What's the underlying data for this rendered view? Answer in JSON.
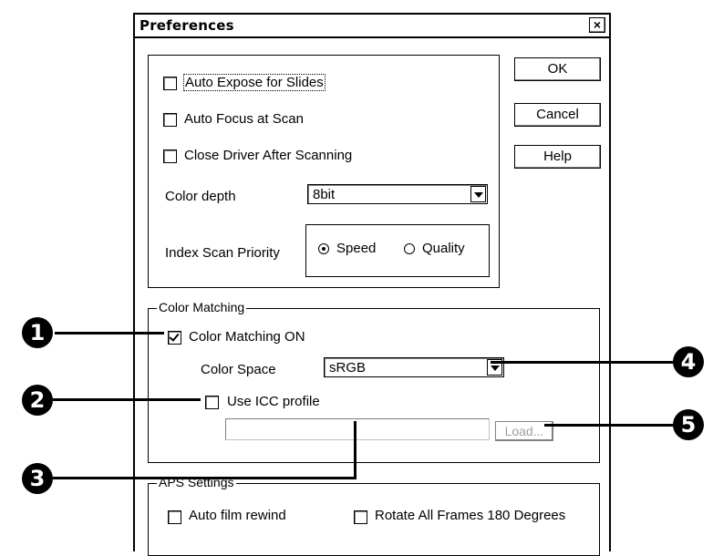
{
  "dialog": {
    "title": "Preferences",
    "close_glyph": "×",
    "ok_label": "OK",
    "cancel_label": "Cancel",
    "help_label": "Help"
  },
  "general": {
    "auto_expose_label": "Auto Expose for Slides",
    "auto_expose_checked": false,
    "auto_focus_label": "Auto Focus at Scan",
    "auto_focus_checked": false,
    "close_driver_label": "Close Driver After Scanning",
    "close_driver_checked": false,
    "color_depth_label": "Color depth",
    "color_depth_value": "8bit",
    "index_scan_label": "Index Scan Priority",
    "speed_label": "Speed",
    "quality_label": "Quality",
    "selected_priority": "Speed"
  },
  "color_matching": {
    "group_label": "Color Matching",
    "on_label": "Color Matching ON",
    "on_checked": true,
    "color_space_label": "Color Space",
    "color_space_value": "sRGB",
    "icc_label": "Use ICC profile",
    "icc_checked": false,
    "profile_path": "",
    "load_label": "Load..."
  },
  "aps": {
    "group_label": "APS Settings",
    "auto_rewind_label": "Auto film rewind",
    "rotate_label": "Rotate All Frames 180 Degrees"
  },
  "callouts": [
    "1",
    "2",
    "3",
    "4",
    "5"
  ]
}
